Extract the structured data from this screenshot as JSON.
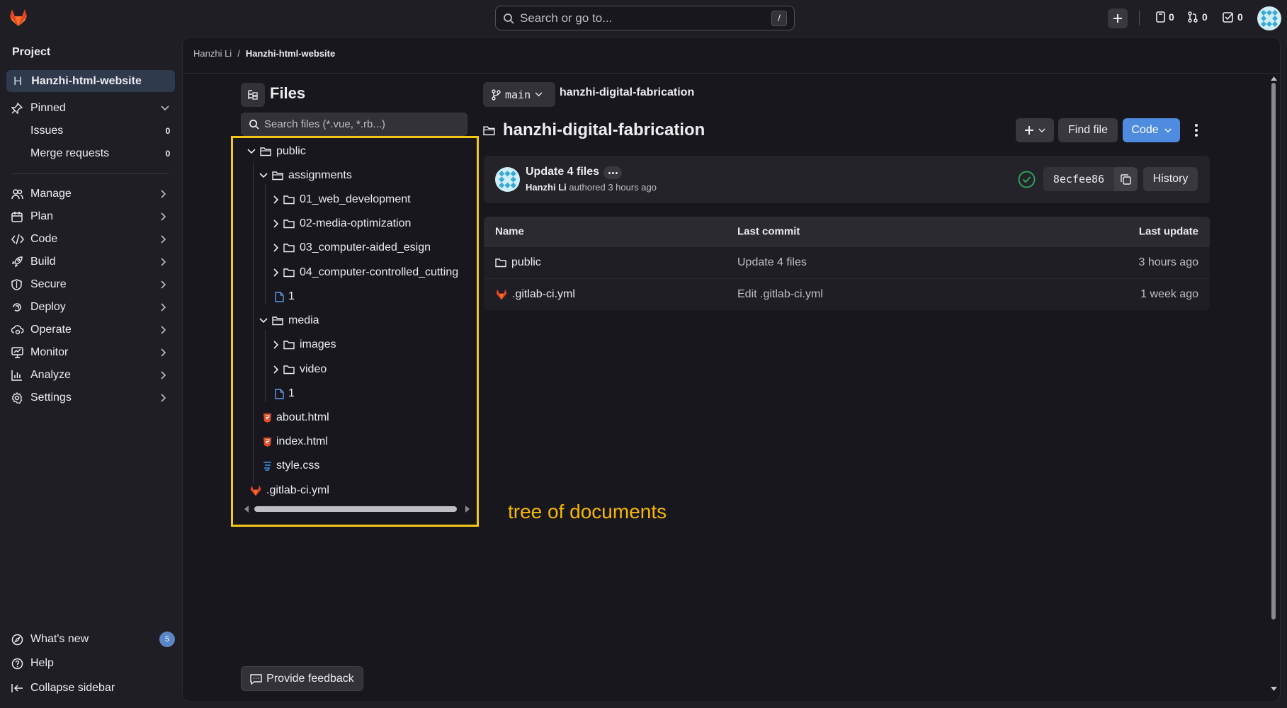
{
  "search": {
    "placeholder": "Search or go to...",
    "shortcut": "/"
  },
  "topbar": {
    "issues_count": "0",
    "mr_count": "0",
    "todo_count": "0"
  },
  "sidebar": {
    "section_title": "Project",
    "project_letter": "H",
    "project_name": "Hanzhi-html-website",
    "pinned_label": "Pinned",
    "pinned_items": [
      {
        "label": "Issues",
        "count": "0"
      },
      {
        "label": "Merge requests",
        "count": "0"
      }
    ],
    "nav_items": [
      {
        "label": "Manage",
        "icon": "users-icon"
      },
      {
        "label": "Plan",
        "icon": "calendar-icon"
      },
      {
        "label": "Code",
        "icon": "code-icon"
      },
      {
        "label": "Build",
        "icon": "rocket-icon"
      },
      {
        "label": "Secure",
        "icon": "shield-icon"
      },
      {
        "label": "Deploy",
        "icon": "deploy-icon"
      },
      {
        "label": "Operate",
        "icon": "cloud-gear-icon"
      },
      {
        "label": "Monitor",
        "icon": "monitor-icon"
      },
      {
        "label": "Analyze",
        "icon": "chart-icon"
      },
      {
        "label": "Settings",
        "icon": "gear-icon"
      }
    ],
    "whats_new": "What's new",
    "whats_new_count": "5",
    "help": "Help",
    "collapse": "Collapse sidebar"
  },
  "breadcrumb": {
    "owner": "Hanzhi Li",
    "separator": "/",
    "project": "Hanzhi-html-website"
  },
  "file_tree": {
    "title": "Files",
    "search_placeholder": "Search files (*.vue, *.rb...)",
    "items": [
      {
        "label": "public",
        "type": "folder",
        "expanded": true
      },
      {
        "label": "assignments",
        "type": "folder",
        "expanded": true
      },
      {
        "label": "01_web_development",
        "type": "folder",
        "expanded": false
      },
      {
        "label": "02-media-optimization",
        "type": "folder",
        "expanded": false
      },
      {
        "label": "03_computer-aided_esign",
        "type": "folder",
        "expanded": false
      },
      {
        "label": "04_computer-controlled_cutting",
        "type": "folder",
        "expanded": false
      },
      {
        "label": "1",
        "type": "file"
      },
      {
        "label": "media",
        "type": "folder",
        "expanded": true
      },
      {
        "label": "images",
        "type": "folder",
        "expanded": false
      },
      {
        "label": "video",
        "type": "folder",
        "expanded": false
      },
      {
        "label": "1",
        "type": "file"
      },
      {
        "label": "about.html",
        "type": "html"
      },
      {
        "label": "index.html",
        "type": "html"
      },
      {
        "label": "style.css",
        "type": "css"
      },
      {
        "label": ".gitlab-ci.yml",
        "type": "gitlab"
      }
    ],
    "annotation": "tree of documents"
  },
  "repo": {
    "branch": "main",
    "path": "hanzhi-digital-fabrication",
    "title": "hanzhi-digital-fabrication",
    "find_file": "Find file",
    "code_button": "Code"
  },
  "commit": {
    "title": "Update 4 files",
    "author": "Hanzhi Li",
    "authored_text": "authored 3 hours ago",
    "sha": "8ecfee86",
    "history": "History"
  },
  "table": {
    "headers": {
      "name": "Name",
      "last_commit": "Last commit",
      "last_update": "Last update"
    },
    "rows": [
      {
        "name": "public",
        "type": "folder",
        "commit": "Update 4 files",
        "updated": "3 hours ago"
      },
      {
        "name": ".gitlab-ci.yml",
        "type": "gitlab",
        "commit": "Edit .gitlab-ci.yml",
        "updated": "1 week ago"
      }
    ]
  },
  "feedback_button": "Provide feedback",
  "colors": {
    "accent_blue": "#4f8ce0",
    "highlight_box": "#f5c518",
    "gitlab_orange": "#e24329",
    "success_green": "#2da160"
  }
}
